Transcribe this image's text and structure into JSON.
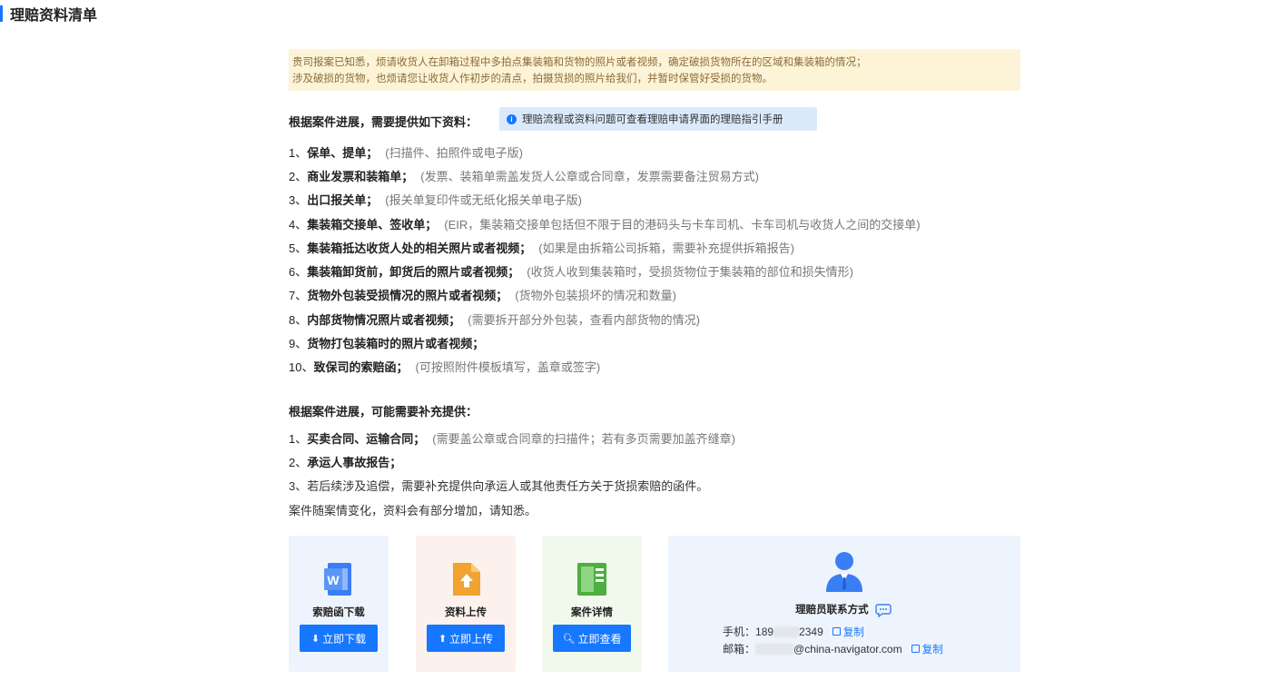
{
  "page": {
    "title": "理赔资料清单"
  },
  "notice": {
    "line1": "贵司报案已知悉，烦请收货人在卸箱过程中多拍点集装箱和货物的照片或者视频，确定破损货物所在的区域和集装箱的情况；",
    "line2": "涉及破损的货物，也烦请您让收货人作初步的清点，拍摄货损的照片给我们，并暂时保管好受损的货物。"
  },
  "required": {
    "heading": "根据案件进展，需要提供如下资料：",
    "tip": "理赔流程或资料问题可查看理赔申请界面的理赔指引手册",
    "items": [
      {
        "num": "1、",
        "title": "保单、提单；",
        "note": "(扫描件、拍照件或电子版)"
      },
      {
        "num": "2、",
        "title": "商业发票和装箱单；",
        "note": "(发票、装箱单需盖发货人公章或合同章，发票需要备注贸易方式)"
      },
      {
        "num": "3、",
        "title": "出口报关单；",
        "note": "(报关单复印件或无纸化报关单电子版)"
      },
      {
        "num": "4、",
        "title": "集装箱交接单、签收单；",
        "note": "(EIR，集装箱交接单包括但不限于目的港码头与卡车司机、卡车司机与收货人之间的交接单)"
      },
      {
        "num": "5、",
        "title": "集装箱抵达收货人处的相关照片或者视频；",
        "note": "(如果是由拆箱公司拆箱，需要补充提供拆箱报告)"
      },
      {
        "num": "6、",
        "title": "集装箱卸货前，卸货后的照片或者视频；",
        "note": "(收货人收到集装箱时，受损货物位于集装箱的部位和损失情形)"
      },
      {
        "num": "7、",
        "title": "货物外包装受损情况的照片或者视频；",
        "note": "(货物外包装损坏的情况和数量)"
      },
      {
        "num": "8、",
        "title": "内部货物情况照片或者视频；",
        "note": "(需要拆开部分外包装，查看内部货物的情况)"
      },
      {
        "num": "9、",
        "title": "货物打包装箱时的照片或者视频；",
        "note": ""
      },
      {
        "num": "10、",
        "title": "致保司的索赔函；",
        "note": "(可按照附件模板填写，盖章或签字)"
      }
    ]
  },
  "supplement": {
    "heading": "根据案件进展，可能需要补充提供：",
    "items": [
      {
        "num": "1、",
        "title": "买卖合同、运输合同；",
        "note": "(需要盖公章或合同章的扫描件；若有多页需要加盖齐缝章)"
      },
      {
        "num": "2、",
        "title": "承运人事故报告；",
        "note": ""
      }
    ],
    "item3": "3、若后续涉及追偿，需要补充提供向承运人或其他责任方关于货损索赔的函件。",
    "footer": "案件随案情变化，资料会有部分增加，请知悉。"
  },
  "cards": [
    {
      "label": "索赔函下载",
      "button": "立即下载",
      "bg": "#eef4fd",
      "icon": "word-doc-icon",
      "iconColor": "#3a7ef5"
    },
    {
      "label": "资料上传",
      "button": "立即上传",
      "bg": "#fcf1ec",
      "icon": "upload-doc-icon",
      "iconColor": "#f0a32f"
    },
    {
      "label": "案件详情",
      "button": "立即查看",
      "bg": "#f1f9ec",
      "icon": "details-doc-icon",
      "iconColor": "#4caf3f"
    }
  ],
  "contact": {
    "title": "理赔员联系方式",
    "phone_label": "手机：",
    "phone_prefix": "189",
    "phone_suffix": "2349",
    "email_label": "邮箱：",
    "email_domain": "@china-navigator.com",
    "copy_label": "复制"
  }
}
